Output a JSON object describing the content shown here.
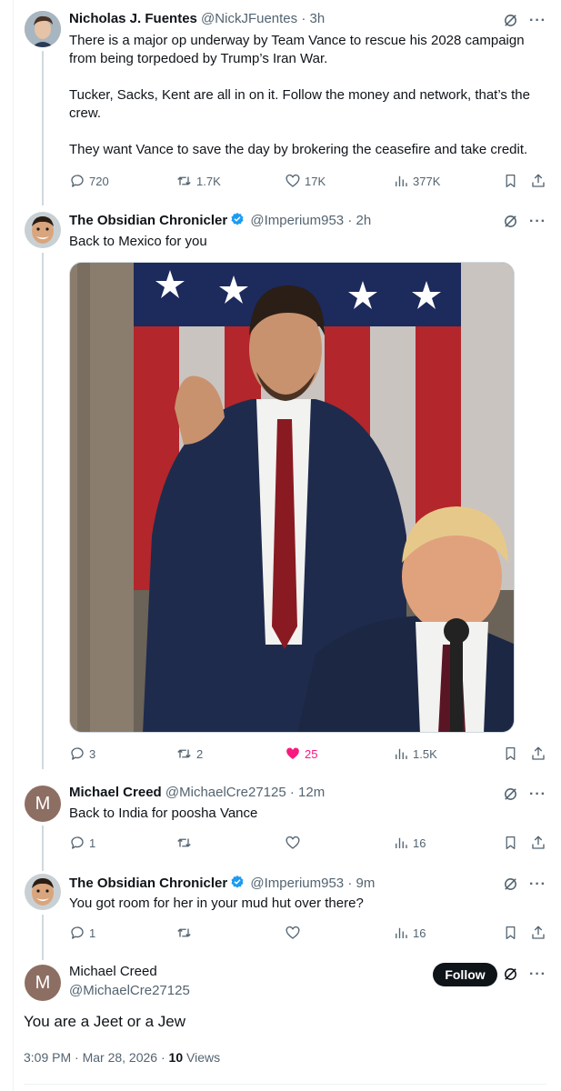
{
  "tweet1": {
    "name": "Nicholas J. Fuentes",
    "handle": "@NickJFuentes",
    "time": "· 3h",
    "paragraphs": [
      "There is a major op underway by Team Vance to rescue his 2028 campaign from being torpedoed by Trump’s Iran War.",
      "Tucker, Sacks, Kent are all in on it. Follow the money and network, that’s the crew.",
      "They want Vance to save the day by brokering the ceasefire and take credit."
    ],
    "replies": "720",
    "reposts": "1.7K",
    "likes": "17K",
    "views": "377K"
  },
  "tweet2": {
    "name": "The Obsidian Chronicler",
    "handle": "@Imperium953",
    "time": "· 2h",
    "text": "Back to Mexico for you",
    "replies": "3",
    "reposts": "2",
    "likes": "25",
    "views": "1.5K"
  },
  "tweet3": {
    "name": "Michael Creed",
    "handle": "@MichaelCre27125",
    "time": "· 12m",
    "text": "Back to India for poosha Vance",
    "avatar_letter": "M",
    "replies": "1",
    "views": "16"
  },
  "tweet4": {
    "name": "The Obsidian Chronicler",
    "handle": "@Imperium953",
    "time": "· 9m",
    "text": "You got room for her in your mud hut over there?",
    "replies": "1",
    "views": "16"
  },
  "focus": {
    "name": "Michael Creed",
    "handle": "@MichaelCre27125",
    "avatar_letter": "M",
    "follow_label": "Follow",
    "text": "You are a Jeet or a Jew",
    "timestamp": "3:09 PM · Mar 28, 2026 · ",
    "views_count": "10",
    "views_label": " Views"
  },
  "colors": {
    "like": "#f91880",
    "verified": "#1d9bf0",
    "muted": "#536471",
    "text": "#0f1419"
  }
}
